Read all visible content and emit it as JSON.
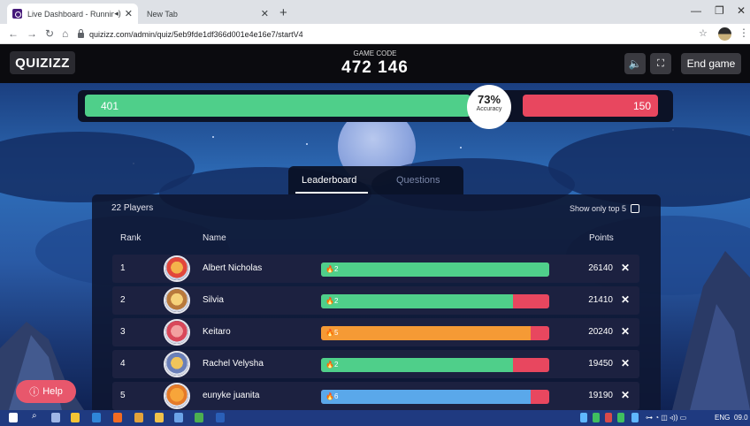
{
  "browser": {
    "tabs": [
      {
        "title": "Live Dashboard - Running",
        "active": true
      },
      {
        "title": "New Tab",
        "active": false
      }
    ],
    "url": "quizizz.com/admin/quiz/5eb9fde1df366d001e4e16e7/startV4"
  },
  "header": {
    "logo": "QUIZIZZ",
    "game_code_label": "GAME CODE",
    "game_code": "472 146",
    "end_game_label": "End game"
  },
  "score": {
    "correct": "401",
    "incorrect": "150",
    "accuracy": "73%",
    "accuracy_label": "Accuracy"
  },
  "tabs": {
    "leaderboard": "Leaderboard",
    "questions": "Questions"
  },
  "leaderboard": {
    "players_count": "22 Players",
    "show_top5": "Show only top 5",
    "col_rank": "Rank",
    "col_name": "Name",
    "col_points": "Points",
    "rows": [
      {
        "rank": "1",
        "name": "Albert Nicholas",
        "streak": "2",
        "points": "26140",
        "fill": 1.0,
        "fill_color": "#4fcf8a"
      },
      {
        "rank": "2",
        "name": "Silvia",
        "streak": "2",
        "points": "21410",
        "fill": 0.84,
        "fill_color": "#4fcf8a"
      },
      {
        "rank": "3",
        "name": "Keitaro",
        "streak": "5",
        "points": "20240",
        "fill": 0.92,
        "fill_color": "#f59a35"
      },
      {
        "rank": "4",
        "name": "Rachel Velysha",
        "streak": "2",
        "points": "19450",
        "fill": 0.84,
        "fill_color": "#4fcf8a"
      },
      {
        "rank": "5",
        "name": "eunyke juanita",
        "streak": "6",
        "points": "19190",
        "fill": 0.92,
        "fill_color": "#5aa8ea"
      }
    ]
  },
  "help_label": "Help",
  "taskbar": {
    "lang": "ENG",
    "time": "09.0"
  }
}
